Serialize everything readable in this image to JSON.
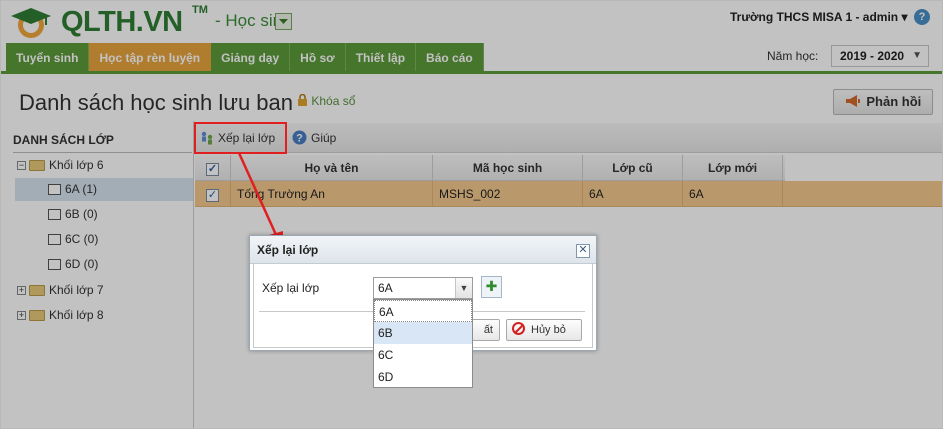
{
  "header": {
    "logo_text": "QLTH.VN",
    "logo_tm": "TM",
    "module": "- Học sinh",
    "school_user": "Trường THCS MISA 1 - admin ▾",
    "help_glyph": "?"
  },
  "tabs": [
    {
      "label": "Tuyển sinh",
      "active": false
    },
    {
      "label": "Học tập rèn luyện",
      "active": true
    },
    {
      "label": "Giảng dạy",
      "active": false
    },
    {
      "label": "Hồ sơ",
      "active": false
    },
    {
      "label": "Thiết lập",
      "active": false
    },
    {
      "label": "Báo cáo",
      "active": false
    }
  ],
  "school_year": {
    "label": "Năm học:",
    "value": "2019 - 2020"
  },
  "page": {
    "title": "Danh sách học sinh lưu ban",
    "lock_label": "Khóa sổ",
    "feedback_label": "Phản hồi"
  },
  "sidebar": {
    "heading": "DANH SÁCH LỚP",
    "groups": [
      {
        "label": "Khối lớp 6",
        "expanded": true,
        "classes": [
          {
            "label": "6A (1)",
            "selected": true
          },
          {
            "label": "6B (0)",
            "selected": false
          },
          {
            "label": "6C (0)",
            "selected": false
          },
          {
            "label": "6D (0)",
            "selected": false
          }
        ]
      },
      {
        "label": "Khối lớp 7",
        "expanded": false
      },
      {
        "label": "Khối lớp 8",
        "expanded": false
      }
    ]
  },
  "toolbar": {
    "rearrange_label": "Xếp lại lớp",
    "help_label": "Giúp"
  },
  "grid": {
    "columns": [
      "Họ và tên",
      "Mã học sinh",
      "Lớp cũ",
      "Lớp mới"
    ],
    "rows": [
      {
        "checked": true,
        "name": "Tống Trường An",
        "code": "MSHS_002",
        "old_class": "6A",
        "new_class": "6A"
      }
    ]
  },
  "dialog": {
    "title": "Xếp lại lớp",
    "field_label": "Xếp lại lớp",
    "field_value": "6A",
    "ok_label_partial": "ất",
    "cancel_label": "Hủy bỏ",
    "options": [
      "6A",
      "6B",
      "6C",
      "6D"
    ],
    "hover_option": "6B"
  },
  "colors": {
    "brand_green": "#5c9a3a",
    "active_tab": "#e8a33d",
    "selected_row": "#f3c98f",
    "annotation_red": "#e02020"
  }
}
